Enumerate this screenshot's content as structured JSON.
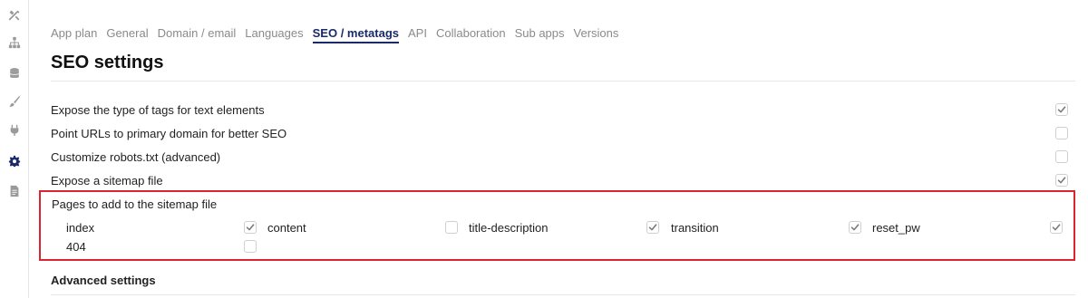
{
  "sidebar": {
    "icons": [
      {
        "name": "tools-icon",
        "active": false
      },
      {
        "name": "sitemap-icon",
        "active": false
      },
      {
        "name": "database-icon",
        "active": false
      },
      {
        "name": "brush-icon",
        "active": false
      },
      {
        "name": "plug-icon",
        "active": false
      },
      {
        "name": "gear-icon",
        "active": true
      },
      {
        "name": "document-icon",
        "active": false
      }
    ],
    "active_color": "#1a2a6b",
    "inactive_color": "#9a9a9a"
  },
  "tabs": [
    {
      "label": "App plan",
      "active": false
    },
    {
      "label": "General",
      "active": false
    },
    {
      "label": "Domain / email",
      "active": false
    },
    {
      "label": "Languages",
      "active": false
    },
    {
      "label": "SEO / metatags",
      "active": true
    },
    {
      "label": "API",
      "active": false
    },
    {
      "label": "Collaboration",
      "active": false
    },
    {
      "label": "Sub apps",
      "active": false
    },
    {
      "label": "Versions",
      "active": false
    }
  ],
  "page": {
    "title": "SEO settings"
  },
  "settings": [
    {
      "label": "Expose the type of tags for text elements",
      "checked": true
    },
    {
      "label": "Point URLs to primary domain for better SEO",
      "checked": false
    },
    {
      "label": "Customize robots.txt (advanced)",
      "checked": false
    },
    {
      "label": "Expose a sitemap file",
      "checked": true
    }
  ],
  "sitemap": {
    "title": "Pages to add to the sitemap file",
    "pages": [
      {
        "label": "index",
        "checked": true
      },
      {
        "label": "content",
        "checked": false
      },
      {
        "label": "title-description",
        "checked": true
      },
      {
        "label": "transition",
        "checked": true
      },
      {
        "label": "reset_pw",
        "checked": true
      },
      {
        "label": "404",
        "checked": false
      }
    ],
    "highlight_color": "#d9252e"
  },
  "advanced": {
    "title": "Advanced settings"
  }
}
